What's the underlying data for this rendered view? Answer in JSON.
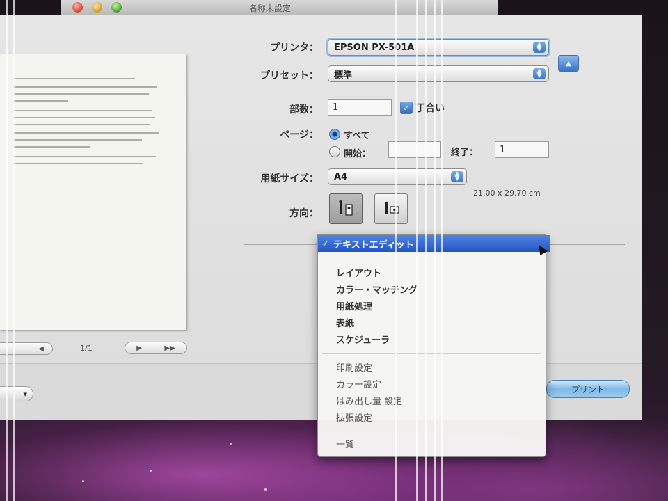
{
  "window": {
    "title": "名称未設定"
  },
  "printer": {
    "label": "プリンタ：",
    "value": "EPSON PX-501A"
  },
  "preset": {
    "label": "プリセット：",
    "value": "標準"
  },
  "copies": {
    "label": "部数：",
    "value": "1",
    "collate_label": "丁合い"
  },
  "pages": {
    "label": "ページ：",
    "all_label": "すべて",
    "from_label": "開始：",
    "to_label": "終了：",
    "to_value": "1"
  },
  "paper_size": {
    "label": "用紙サイズ：",
    "value": "A4",
    "dimensions": "21.00 x 29.70 cm"
  },
  "orientation": {
    "label": "方向："
  },
  "preview": {
    "page_counter": "1/1"
  },
  "buttons": {
    "print": "プリント"
  },
  "menu": {
    "selected": "テキストエディット",
    "items_top": [
      "レイアウト",
      "カラー・マッチング",
      "用紙処理",
      "表紙",
      "スケジューラ"
    ],
    "items_mid": [
      "印刷設定",
      "カラー設定",
      "はみ出し量 設定",
      "拡張設定"
    ],
    "items_bottom": [
      "一覧"
    ]
  },
  "colors": {
    "selection": "#2456c4",
    "print_button": "#7eb8e8"
  }
}
